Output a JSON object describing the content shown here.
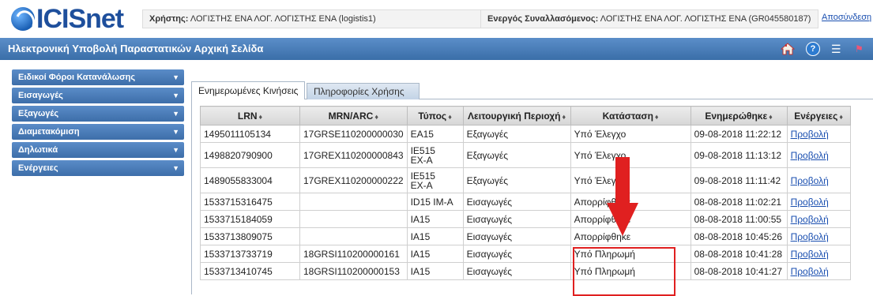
{
  "header": {
    "logo_text": "ICISnet",
    "user_label": "Χρήστης:",
    "user_value": "ΛΟΓΙΣΤΗΣ ΕΝΑ ΛΟΓ. ΛΟΓΙΣΤΗΣ ΕΝΑ (logistis1)",
    "trader_label": "Ενεργός Συναλλασόμενος:",
    "trader_value": "ΛΟΓΙΣΤΗΣ ΕΝΑ ΛΟΓ. ΛΟΓΙΣΤΗΣ ΕΝΑ (GR045580187)",
    "logout_link": "Αποσύνδεση"
  },
  "titlebar": {
    "title": "Ηλεκτρονική Υποβολή Παραστατικών Αρχική Σελίδα",
    "icons": [
      "home-icon",
      "help-icon",
      "menu-icon",
      "flag-icon"
    ],
    "help_glyph": "?"
  },
  "sidebar": {
    "items": [
      {
        "label": "Ειδικοί Φόροι Κατανάλωσης"
      },
      {
        "label": "Εισαγωγές"
      },
      {
        "label": "Εξαγωγές"
      },
      {
        "label": "Διαμετακόμιση"
      },
      {
        "label": "Δηλωτικά"
      },
      {
        "label": "Ενέργειες"
      }
    ]
  },
  "tabs": [
    {
      "label": "Ενημερωμένες Κινήσεις",
      "active": true
    },
    {
      "label": "Πληροφορίες Χρήσης",
      "active": false
    }
  ],
  "table": {
    "columns": [
      "LRN",
      "MRN/ARC",
      "Τύπος",
      "Λειτουργική Περιοχή",
      "Κατάσταση",
      "Ενημερώθηκε",
      "Ενέργειες"
    ],
    "sort_glyph": "♦",
    "rows": [
      {
        "lrn": "1495011105134",
        "mrn": "17GRSE110200000030",
        "type": "EA15",
        "area": "Εξαγωγές",
        "status": "Υπό Έλεγχο",
        "updated": "09-08-2018 11:22:12",
        "action": "Προβολή"
      },
      {
        "lrn": "1498820790900",
        "mrn": "17GREX110200000843",
        "type": "IE515 EX-A",
        "area": "Εξαγωγές",
        "status": "Υπό Έλεγχο",
        "updated": "09-08-2018 11:13:12",
        "action": "Προβολή"
      },
      {
        "lrn": "1489055833004",
        "mrn": "17GREX110200000222",
        "type": "IE515 EX-A",
        "area": "Εξαγωγές",
        "status": "Υπό Έλεγχο",
        "updated": "09-08-2018 11:11:42",
        "action": "Προβολή"
      },
      {
        "lrn": "1533715316475",
        "mrn": "",
        "type": "ID15 IM-A",
        "area": "Εισαγωγές",
        "status": "Απορρίφθηκε",
        "updated": "08-08-2018 11:02:21",
        "action": "Προβολή"
      },
      {
        "lrn": "1533715184059",
        "mrn": "",
        "type": "IA15",
        "area": "Εισαγωγές",
        "status": "Απορρίφθηκε",
        "updated": "08-08-2018 11:00:55",
        "action": "Προβολή"
      },
      {
        "lrn": "1533713809075",
        "mrn": "",
        "type": "IA15",
        "area": "Εισαγωγές",
        "status": "Απορρίφθηκε",
        "updated": "08-08-2018 10:45:26",
        "action": "Προβολή"
      },
      {
        "lrn": "1533713733719",
        "mrn": "18GRSI110200000161",
        "type": "IA15",
        "area": "Εισαγωγές",
        "status": "Υπό Πληρωμή",
        "updated": "08-08-2018 10:41:28",
        "action": "Προβολή"
      },
      {
        "lrn": "1533713410745",
        "mrn": "18GRSI110200000153",
        "type": "IA15",
        "area": "Εισαγωγές",
        "status": "Υπό Πληρωμή",
        "updated": "08-08-2018 10:41:27",
        "action": "Προβολή"
      }
    ]
  },
  "colors": {
    "brand_blue": "#1e4f9c",
    "titlebar_blue": "#3a6ea8",
    "link_blue": "#1a4fb0",
    "annotation_red": "#e02020"
  }
}
